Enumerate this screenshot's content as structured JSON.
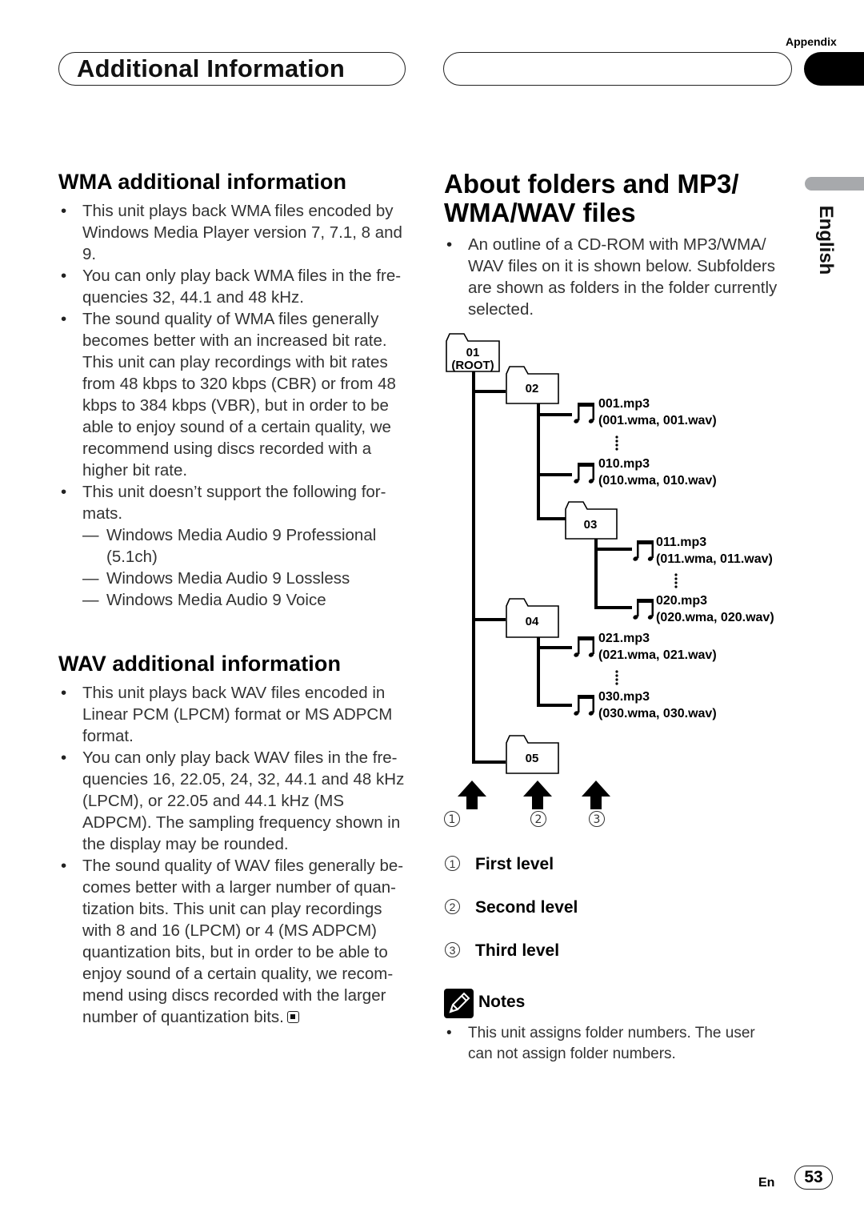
{
  "header": {
    "section_label": "Appendix",
    "chapter_title": "Additional Information",
    "side_tab_language": "English"
  },
  "wma_section": {
    "heading": "WMA additional information",
    "bullets": [
      "This unit plays back WMA files encoded by Windows Media Player version 7, 7.1, 8 and 9.",
      "You can only play back WMA files in the fre-quencies 32, 44.1 and 48 kHz.",
      "The sound quality of WMA files generally becomes better with an increased bit rate. This unit can play recordings with bit rates from 48 kbps to 320 kbps (CBR) or from 48 kbps to 384 kbps (VBR), but in order to be able to enjoy sound of a certain quality, we recommend using discs recorded with a higher bit rate.",
      "This unit doesn’t support the following for-mats."
    ],
    "unsupported_formats": [
      "Windows Media Audio 9 Professional (5.1ch)",
      "Windows Media Audio 9 Lossless",
      "Windows Media Audio 9 Voice"
    ]
  },
  "wav_section": {
    "heading": "WAV additional information",
    "bullets": [
      "This unit plays back WAV files encoded in Linear PCM (LPCM) format or MS ADPCM format.",
      "You can only play back WAV files in the fre-quencies 16, 22.05, 24, 32, 44.1 and 48 kHz (LPCM), or 22.05 and 44.1 kHz (MS ADPCM). The sampling frequency shown in the display may be rounded.",
      "The sound quality of WAV files generally be-comes better with a larger number of quan-tization bits. This unit can play recordings with 8 and 16 (LPCM) or 4 (MS ADPCM) quantization bits, but in order to be able to enjoy sound of a certain quality, we recom-mend using discs recorded with the larger number of quantization bits."
    ]
  },
  "folders_section": {
    "heading_line1": "About folders and MP3/",
    "heading_line2": "WMA/WAV files",
    "bullets": [
      "An outline of a CD-ROM with MP3/WMA/ WAV files on it is shown below. Subfolders are shown as folders in the folder currently selected."
    ],
    "diagram": {
      "folders": [
        {
          "id": "01",
          "sub": "(ROOT)"
        },
        {
          "id": "02"
        },
        {
          "id": "03"
        },
        {
          "id": "04"
        },
        {
          "id": "05"
        }
      ],
      "files": [
        {
          "name": "001.mp3",
          "alt": "(001.wma, 001.wav)"
        },
        {
          "name": "010.mp3",
          "alt": "(010.wma, 010.wav)"
        },
        {
          "name": "011.mp3",
          "alt": "(011.wma, 011.wav)"
        },
        {
          "name": "020.mp3",
          "alt": "(020.wma, 020.wav)"
        },
        {
          "name": "021.mp3",
          "alt": "(021.wma, 021.wav)"
        },
        {
          "name": "030.mp3",
          "alt": "(030.wma, 030.wav)"
        }
      ],
      "level_markers": [
        "1",
        "2",
        "3"
      ]
    },
    "legend": [
      {
        "num": "1",
        "label": "First level"
      },
      {
        "num": "2",
        "label": "Second level"
      },
      {
        "num": "3",
        "label": "Third level"
      }
    ],
    "notes": {
      "title": "Notes",
      "bullets": [
        "This unit assigns folder numbers. The user can not assign folder numbers."
      ]
    }
  },
  "footer": {
    "language_code": "En",
    "page_number": "53"
  }
}
